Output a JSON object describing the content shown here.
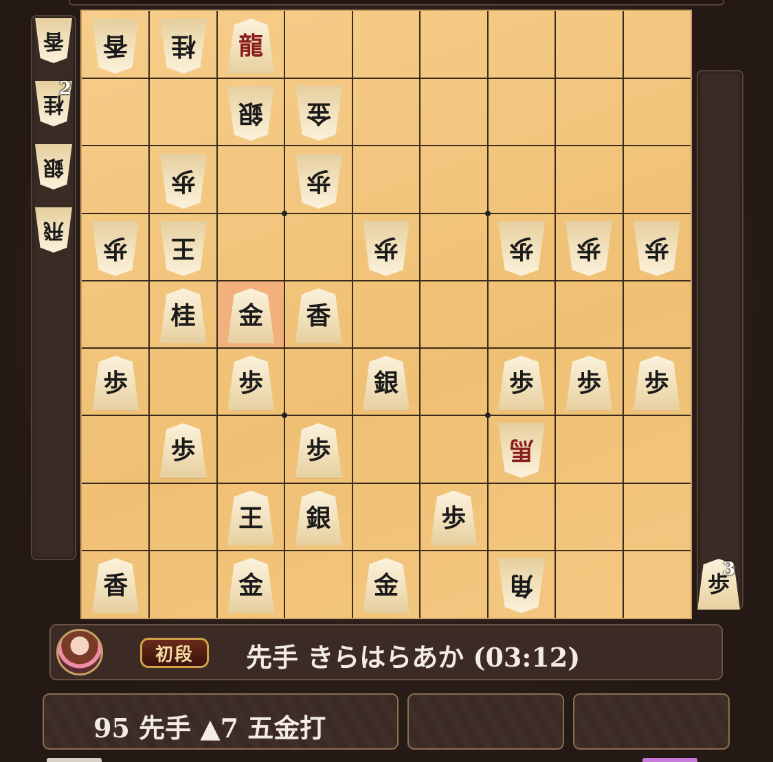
{
  "board": {
    "pieces": [
      {
        "rank": 1,
        "file": 9,
        "char": "香",
        "side": "gote",
        "promoted": false
      },
      {
        "rank": 1,
        "file": 8,
        "char": "桂",
        "side": "gote",
        "promoted": false
      },
      {
        "rank": 1,
        "file": 7,
        "char": "龍",
        "side": "sente",
        "promoted": true
      },
      {
        "rank": 2,
        "file": 7,
        "char": "銀",
        "side": "gote",
        "promoted": false
      },
      {
        "rank": 2,
        "file": 6,
        "char": "金",
        "side": "gote",
        "promoted": false
      },
      {
        "rank": 3,
        "file": 8,
        "char": "歩",
        "side": "gote",
        "promoted": false
      },
      {
        "rank": 3,
        "file": 6,
        "char": "歩",
        "side": "gote",
        "promoted": false
      },
      {
        "rank": 4,
        "file": 9,
        "char": "歩",
        "side": "gote",
        "promoted": false
      },
      {
        "rank": 4,
        "file": 8,
        "char": "王",
        "side": "gote",
        "promoted": false
      },
      {
        "rank": 4,
        "file": 5,
        "char": "歩",
        "side": "gote",
        "promoted": false
      },
      {
        "rank": 4,
        "file": 3,
        "char": "歩",
        "side": "gote",
        "promoted": false
      },
      {
        "rank": 4,
        "file": 2,
        "char": "歩",
        "side": "gote",
        "promoted": false
      },
      {
        "rank": 4,
        "file": 1,
        "char": "歩",
        "side": "gote",
        "promoted": false
      },
      {
        "rank": 5,
        "file": 8,
        "char": "桂",
        "side": "sente",
        "promoted": false
      },
      {
        "rank": 5,
        "file": 7,
        "char": "金",
        "side": "sente",
        "promoted": false
      },
      {
        "rank": 5,
        "file": 6,
        "char": "香",
        "side": "sente",
        "promoted": false
      },
      {
        "rank": 6,
        "file": 9,
        "char": "歩",
        "side": "sente",
        "promoted": false
      },
      {
        "rank": 6,
        "file": 7,
        "char": "歩",
        "side": "sente",
        "promoted": false
      },
      {
        "rank": 6,
        "file": 5,
        "char": "銀",
        "side": "sente",
        "promoted": false
      },
      {
        "rank": 6,
        "file": 3,
        "char": "歩",
        "side": "sente",
        "promoted": false
      },
      {
        "rank": 6,
        "file": 2,
        "char": "歩",
        "side": "sente",
        "promoted": false
      },
      {
        "rank": 6,
        "file": 1,
        "char": "歩",
        "side": "sente",
        "promoted": false
      },
      {
        "rank": 7,
        "file": 8,
        "char": "歩",
        "side": "sente",
        "promoted": false
      },
      {
        "rank": 7,
        "file": 6,
        "char": "歩",
        "side": "sente",
        "promoted": false
      },
      {
        "rank": 7,
        "file": 3,
        "char": "馬",
        "side": "gote",
        "promoted": true
      },
      {
        "rank": 8,
        "file": 7,
        "char": "王",
        "side": "sente",
        "promoted": false
      },
      {
        "rank": 8,
        "file": 6,
        "char": "銀",
        "side": "sente",
        "promoted": false
      },
      {
        "rank": 8,
        "file": 4,
        "char": "歩",
        "side": "sente",
        "promoted": false
      },
      {
        "rank": 9,
        "file": 9,
        "char": "香",
        "side": "sente",
        "promoted": false
      },
      {
        "rank": 9,
        "file": 7,
        "char": "金",
        "side": "sente",
        "promoted": false
      },
      {
        "rank": 9,
        "file": 5,
        "char": "金",
        "side": "sente",
        "promoted": false
      },
      {
        "rank": 9,
        "file": 3,
        "char": "角",
        "side": "gote",
        "promoted": false
      }
    ],
    "highlight": {
      "rank": 5,
      "file": 7
    }
  },
  "gote_hand": [
    {
      "char": "香",
      "count": ""
    },
    {
      "char": "桂",
      "count": "2"
    },
    {
      "char": "銀",
      "count": ""
    },
    {
      "char": "飛",
      "count": ""
    }
  ],
  "sente_hand": [
    {
      "char": "歩",
      "count": "3"
    }
  ],
  "player": {
    "rank_label": "初段",
    "name": "先手 きらはらあか (03:12)"
  },
  "move": {
    "text": "95 先手 ▲7 五金打"
  },
  "colors": {
    "board": "#f2c57e",
    "promoted": "#8a1d1d",
    "highlight": "#f2b07c"
  }
}
